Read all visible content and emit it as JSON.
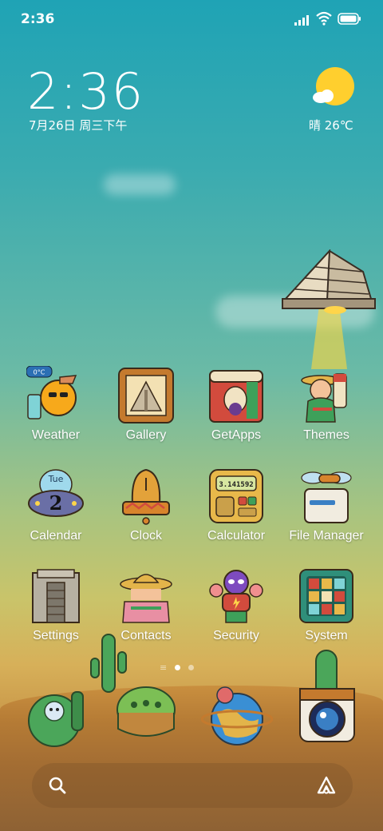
{
  "status_bar": {
    "time": "2:36",
    "signal_icon": "signal-icon",
    "wifi_icon": "wifi-icon",
    "battery_icon": "battery-icon"
  },
  "clock_widget": {
    "time": "2:36",
    "date": "7月26日 周三下午"
  },
  "weather_widget": {
    "icon": "sun-cloud-icon",
    "text": "晴 26℃"
  },
  "apps": [
    {
      "label": "Weather",
      "icon": "weather-icon"
    },
    {
      "label": "Gallery",
      "icon": "gallery-icon"
    },
    {
      "label": "GetApps",
      "icon": "getapps-icon"
    },
    {
      "label": "Themes",
      "icon": "themes-icon"
    },
    {
      "label": "Calendar",
      "icon": "calendar-icon",
      "day": "Tue",
      "date_num": "2"
    },
    {
      "label": "Clock",
      "icon": "clock-icon"
    },
    {
      "label": "Calculator",
      "icon": "calculator-icon",
      "display": "3.141592"
    },
    {
      "label": "File Manager",
      "icon": "file-manager-icon"
    },
    {
      "label": "Settings",
      "icon": "settings-icon"
    },
    {
      "label": "Contacts",
      "icon": "contacts-icon"
    },
    {
      "label": "Security",
      "icon": "security-icon"
    },
    {
      "label": "System",
      "icon": "system-icon"
    }
  ],
  "weather_badge": "0°C",
  "page_indicator": {
    "pages": 2,
    "active": 1
  },
  "dock": [
    {
      "icon": "phone-icon"
    },
    {
      "icon": "messages-icon"
    },
    {
      "icon": "browser-icon"
    },
    {
      "icon": "camera-icon"
    }
  ],
  "search_bar": {
    "search_icon": "search-icon",
    "assistant_icon": "assistant-icon"
  },
  "colors": {
    "sky_top": "#1fa3b5",
    "desert": "#b57b35",
    "sun": "#ffcf2e"
  }
}
